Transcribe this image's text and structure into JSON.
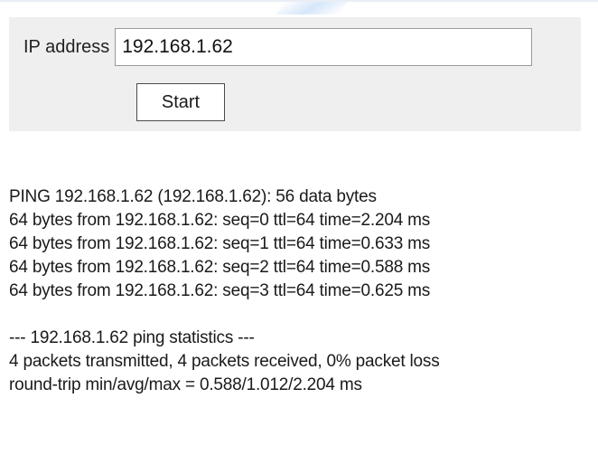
{
  "form": {
    "ip_label": "IP address",
    "ip_value": "192.168.1.62",
    "start_label": "Start"
  },
  "output": {
    "header": "PING 192.168.1.62 (192.168.1.62): 56 data bytes",
    "replies": [
      "64 bytes from 192.168.1.62: seq=0 ttl=64 time=2.204 ms",
      "64 bytes from 192.168.1.62: seq=1 ttl=64 time=0.633 ms",
      "64 bytes from 192.168.1.62: seq=2 ttl=64 time=0.588 ms",
      "64 bytes from 192.168.1.62: seq=3 ttl=64 time=0.625 ms"
    ],
    "stats_title": "--- 192.168.1.62 ping statistics ---",
    "stats_packets": "4 packets transmitted, 4 packets received, 0% packet loss",
    "stats_rtt": "round-trip min/avg/max = 0.588/1.012/2.204 ms"
  },
  "colors": {
    "panel_background": "#efefef",
    "page_background": "#ffffff",
    "text": "#1a1a1a"
  }
}
